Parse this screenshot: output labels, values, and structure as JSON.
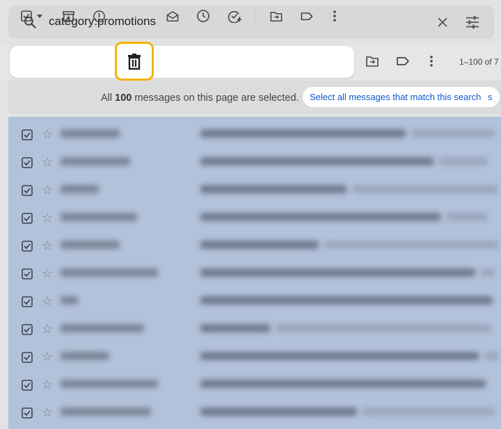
{
  "search": {
    "query": "category:promotions",
    "icon": "search-icon"
  },
  "toolbar": {
    "buttons": [
      "select-checkbox",
      "archive",
      "report-spam",
      "delete",
      "mark-as-read",
      "snooze",
      "add-to-tasks",
      "move-to",
      "label",
      "more"
    ],
    "highlighted": "delete",
    "highlight_color": "#f4b400"
  },
  "pagination": {
    "range": "1–100 of 7"
  },
  "banner": {
    "prefix": "All",
    "count": "100",
    "suffix": "messages on this page are selected.",
    "select_all_label": "Select all messages that match this search",
    "trailing_char": "s"
  },
  "list": {
    "selection_color": "#b3c2db",
    "rows": [
      {
        "sender_width": 85,
        "subject_width": 295,
        "snippet_width": 120
      },
      {
        "sender_width": 100,
        "subject_width": 335,
        "snippet_width": 70
      },
      {
        "sender_width": 55,
        "subject_width": 210,
        "snippet_width": 210
      },
      {
        "sender_width": 110,
        "subject_width": 345,
        "snippet_width": 60
      },
      {
        "sender_width": 85,
        "subject_width": 170,
        "snippet_width": 250
      },
      {
        "sender_width": 140,
        "subject_width": 395,
        "snippet_width": 20
      },
      {
        "sender_width": 25,
        "subject_width": 420,
        "snippet_width": 0
      },
      {
        "sender_width": 120,
        "subject_width": 100,
        "snippet_width": 310
      },
      {
        "sender_width": 70,
        "subject_width": 400,
        "snippet_width": 20
      },
      {
        "sender_width": 140,
        "subject_width": 410,
        "snippet_width": 0
      },
      {
        "sender_width": 130,
        "subject_width": 225,
        "snippet_width": 190
      }
    ]
  }
}
